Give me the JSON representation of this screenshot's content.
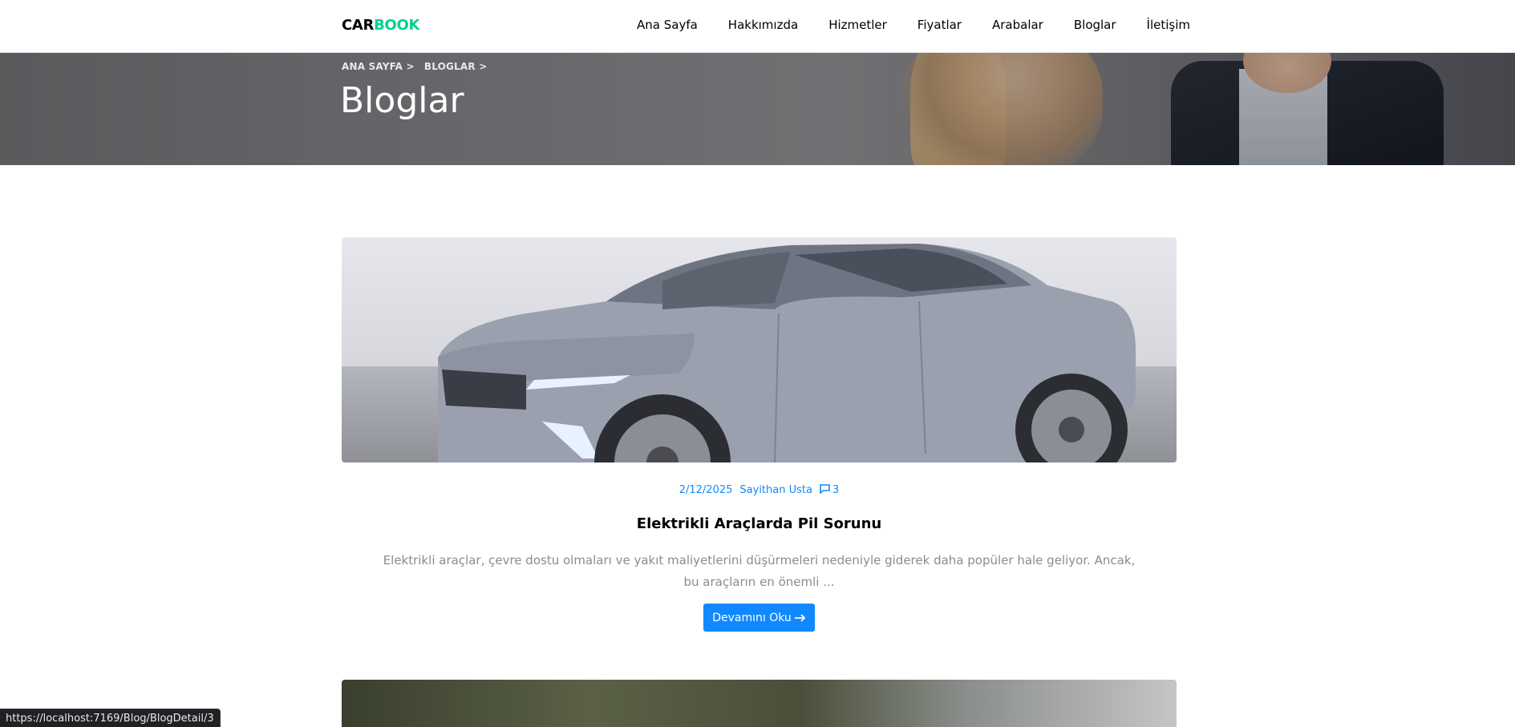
{
  "brand": {
    "part1": "CAR",
    "part2": "BOOK",
    "color_accent": "#01d28e"
  },
  "nav": {
    "items": [
      {
        "label": "Ana Sayfa"
      },
      {
        "label": "Hakkımızda"
      },
      {
        "label": "Hizmetler"
      },
      {
        "label": "Fiyatlar"
      },
      {
        "label": "Arabalar"
      },
      {
        "label": "Bloglar"
      },
      {
        "label": "İletişim"
      }
    ]
  },
  "hero": {
    "breadcrumb": [
      {
        "label": "ANA SAYFA",
        "sep": ">"
      },
      {
        "label": "BLOGLAR",
        "sep": ">"
      }
    ],
    "title": "Bloglar"
  },
  "posts": [
    {
      "date": "2/12/2025",
      "author": "Sayithan Usta",
      "comments": "3",
      "title": "Elektrikli Araçlarda Pil Sorunu",
      "excerpt": "Elektrikli araçlar, çevre dostu olmaları ve yakıt maliyetlerini düşürmeleri nedeniyle giderek daha popüler hale geliyor. Ancak, bu araçların en önemli ...",
      "read_more": "Devamını Oku",
      "read_more_icon": "arrow-right-icon"
    }
  ],
  "colors": {
    "primary": "#1089ff",
    "text_muted": "#8c8c8c"
  },
  "status_bar": {
    "url": "https://localhost:7169/Blog/BlogDetail/3"
  }
}
